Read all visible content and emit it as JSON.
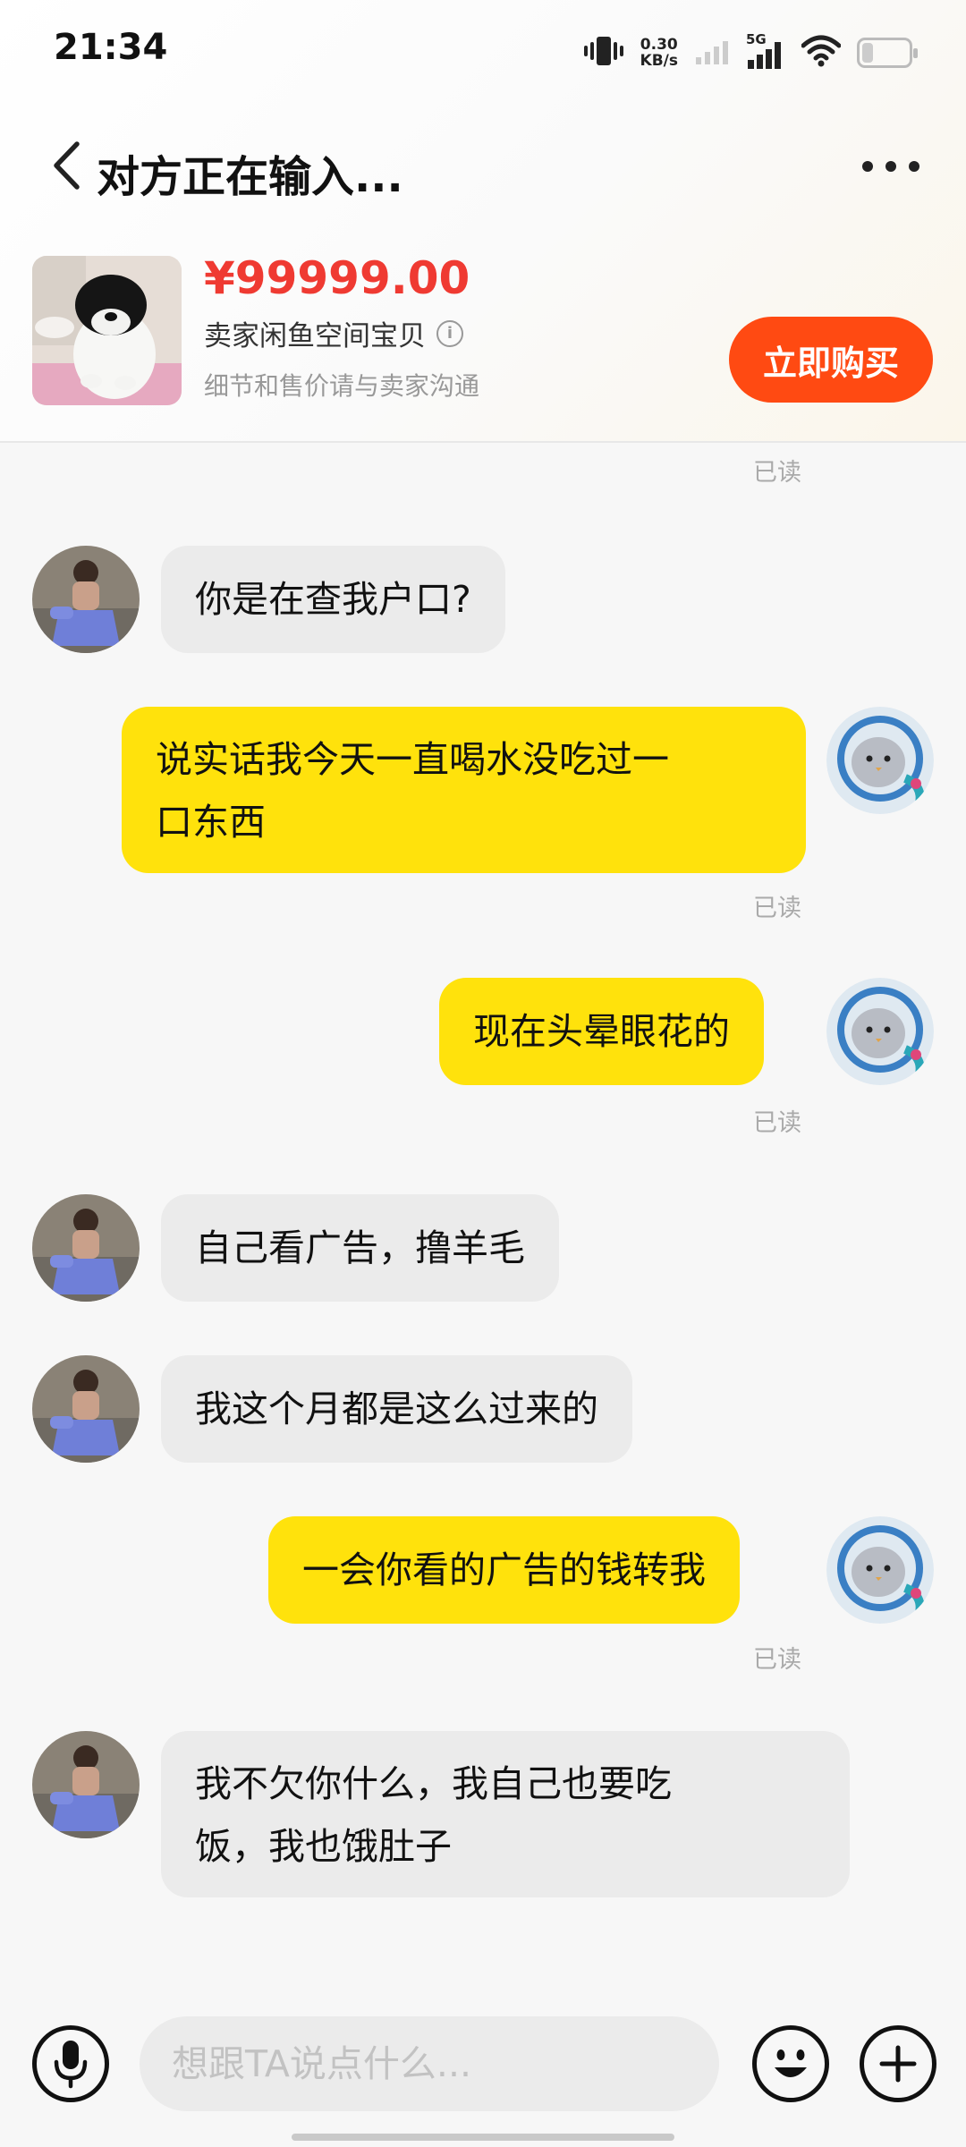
{
  "status_bar": {
    "time": "21:34",
    "net_speed_value": "0.30",
    "net_speed_unit": "KB/s",
    "network": "5G"
  },
  "header": {
    "title": "对方正在输入..."
  },
  "product": {
    "price": "¥99999.00",
    "seller": "卖家闲鱼空间宝贝",
    "note": "细节和售价请与卖家沟通",
    "buy_label": "立即购买"
  },
  "chat": {
    "read_label": "已读",
    "messages": [
      {
        "side": "left",
        "lines": [
          "你是在查我户口?"
        ]
      },
      {
        "side": "right",
        "lines": [
          "说实话我今天一直喝水没吃过一",
          "口东西"
        ],
        "read": true
      },
      {
        "side": "right",
        "lines": [
          "现在头晕眼花的"
        ],
        "read": true
      },
      {
        "side": "left",
        "lines": [
          "自己看广告，撸羊毛"
        ]
      },
      {
        "side": "left",
        "lines": [
          "我这个月都是这么过来的"
        ]
      },
      {
        "side": "right",
        "lines": [
          "一会你看的广告的钱转我"
        ],
        "read": true
      },
      {
        "side": "left",
        "lines": [
          "我不欠你什么，我自己也要吃",
          "饭，我也饿肚子"
        ]
      }
    ]
  },
  "input_bar": {
    "placeholder": "想跟TA说点什么..."
  },
  "colors": {
    "accent": "#ff4a12",
    "price": "#ef3a32",
    "bubble_self": "#ffe20c",
    "bubble_other": "#ebebeb"
  },
  "icons": [
    "back-arrow-icon",
    "more-dots-icon",
    "info-icon",
    "microphone-icon",
    "emoji-icon",
    "plus-icon",
    "vibrate-icon",
    "signal-icon",
    "wifi-icon",
    "battery-icon"
  ]
}
